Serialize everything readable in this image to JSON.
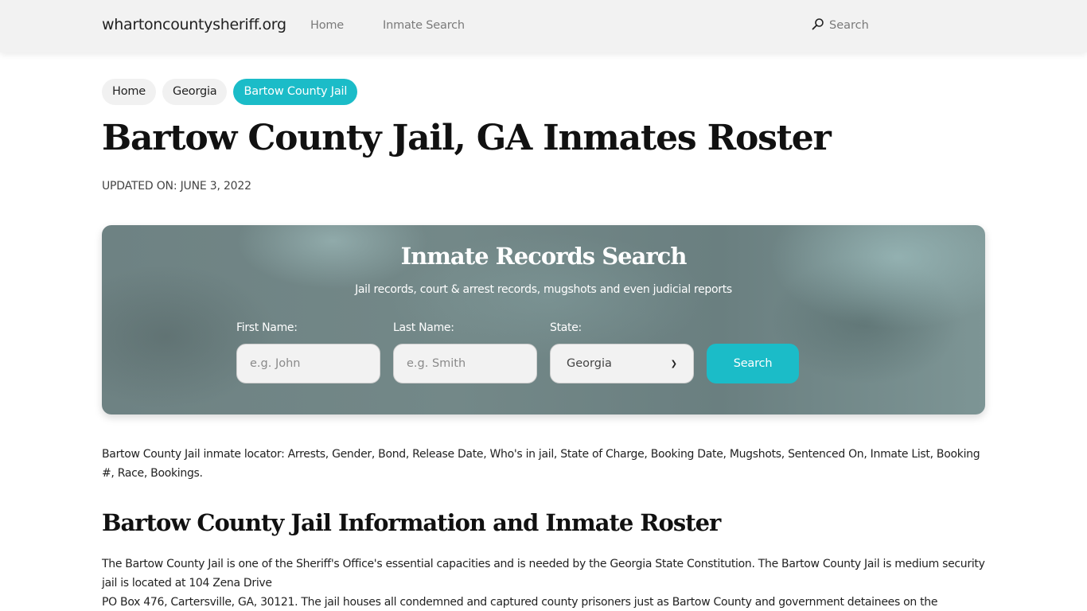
{
  "navbar": {
    "brand": "whartoncountysheriff.org",
    "links": [
      {
        "label": "Home"
      },
      {
        "label": "Inmate Search"
      }
    ],
    "search_label": "Search",
    "search_icon": "search-icon"
  },
  "breadcrumb": [
    {
      "label": "Home",
      "active": false
    },
    {
      "label": "Georgia",
      "active": false
    },
    {
      "label": "Bartow County Jail",
      "active": true
    }
  ],
  "page": {
    "title": "Bartow County Jail, GA Inmates Roster",
    "updated": "UPDATED ON: JUNE 3, 2022"
  },
  "search_card": {
    "title": "Inmate Records Search",
    "subtitle": "Jail records, court & arrest records, mugshots and even judicial reports",
    "first_name_label": "First Name:",
    "first_name_placeholder": "e.g. John",
    "first_name_value": "",
    "last_name_label": "Last Name:",
    "last_name_placeholder": "e.g. Smith",
    "last_name_value": "",
    "state_label": "State:",
    "state_selected": "Georgia",
    "button_label": "Search"
  },
  "content": {
    "intro": "Bartow County Jail inmate locator: Arrests, Gender, Bond, Release Date, Who's in jail, State of Charge, Booking Date, Mugshots, Sentenced On, Inmate List, Booking #, Race, Bookings.",
    "section_title": "Bartow County Jail Information and Inmate Roster",
    "body_line1": "The Bartow County Jail is one of the Sheriff's Office's essential capacities and is needed by the Georgia State Constitution. The Bartow County Jail is medium security jail is located at 104 Zena Drive",
    "body_line2": "PO Box 476, Cartersville, GA, 30121. The jail houses all condemned and captured county prisoners just as Bartow County and government detainees on the"
  },
  "colors": {
    "accent": "#1bbcc8",
    "navbar_bg": "#f2f2f2"
  }
}
